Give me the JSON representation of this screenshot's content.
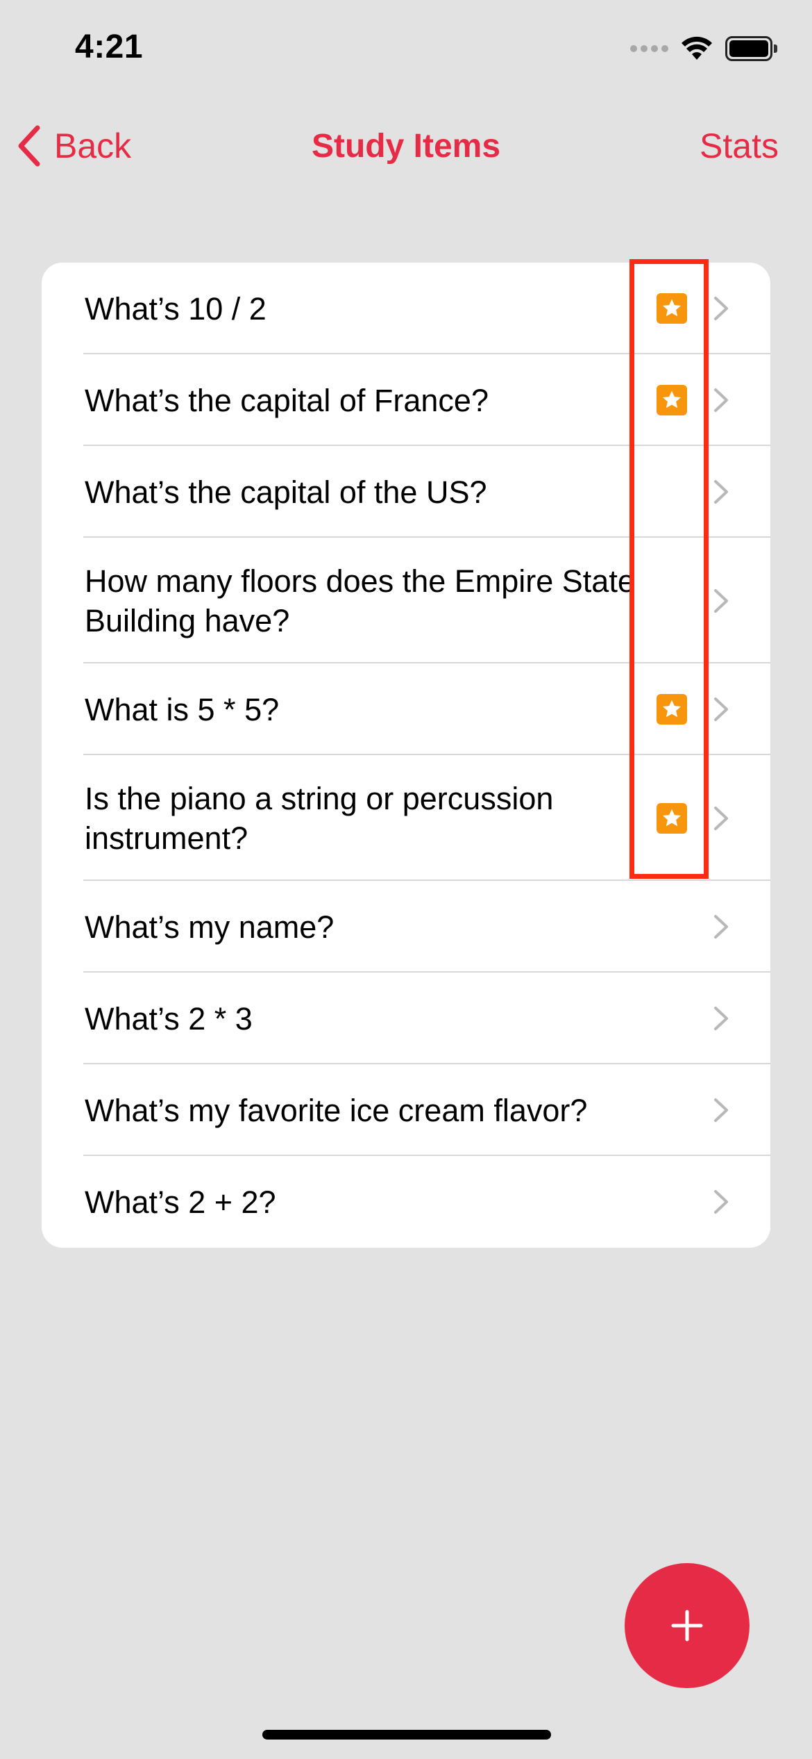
{
  "status_bar": {
    "time": "4:21"
  },
  "nav": {
    "back_label": "Back",
    "title": "Study Items",
    "stats_label": "Stats"
  },
  "items": [
    {
      "label": "What’s 10 / 2",
      "starred": true
    },
    {
      "label": "What’s the capital of France?",
      "starred": true
    },
    {
      "label": "What’s the capital of the US?",
      "starred": false
    },
    {
      "label": "How many floors does the Empire State Building have?",
      "starred": false
    },
    {
      "label": "What is 5 * 5?",
      "starred": true
    },
    {
      "label": "Is the piano a string or percussion instrument?",
      "starred": true
    },
    {
      "label": "What’s my name?",
      "starred": false
    },
    {
      "label": "What’s 2 * 3",
      "starred": false
    },
    {
      "label": "What’s my favorite ice cream flavor?",
      "starred": false
    },
    {
      "label": "What’s 2 + 2?",
      "starred": false
    }
  ],
  "colors": {
    "accent": "#e52b45",
    "star_badge": "#f7950c",
    "highlight": "#ff2a12",
    "background": "#e2e2e2"
  }
}
